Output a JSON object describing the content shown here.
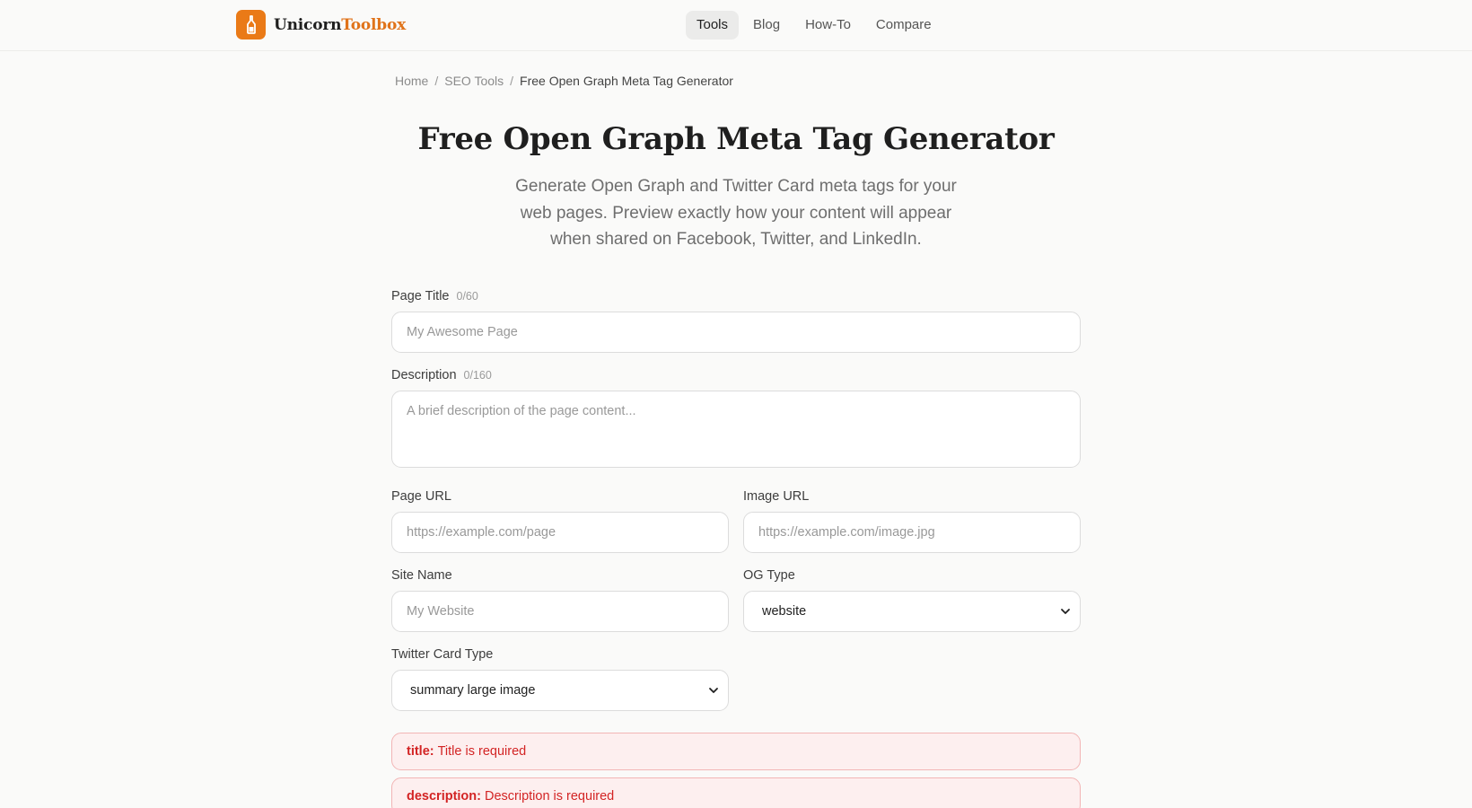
{
  "header": {
    "logo": {
      "part1": "Unicorn",
      "part2": "Toolbox",
      "icon": "unicorn-bottle-icon"
    },
    "nav": [
      {
        "label": "Tools",
        "active": true
      },
      {
        "label": "Blog",
        "active": false
      },
      {
        "label": "How-To",
        "active": false
      },
      {
        "label": "Compare",
        "active": false
      }
    ]
  },
  "breadcrumb": {
    "home": "Home",
    "section": "SEO Tools",
    "current": "Free Open Graph Meta Tag Generator",
    "separator": "/"
  },
  "page": {
    "title": "Free Open Graph Meta Tag Generator",
    "subtitle": "Generate Open Graph and Twitter Card meta tags for your web pages. Preview exactly how your content will appear when shared on Facebook, Twitter, and LinkedIn."
  },
  "form": {
    "page_title": {
      "label": "Page Title",
      "count": "0/60",
      "placeholder": "My Awesome Page",
      "value": ""
    },
    "description": {
      "label": "Description",
      "count": "0/160",
      "placeholder": "A brief description of the page content...",
      "value": ""
    },
    "page_url": {
      "label": "Page URL",
      "placeholder": "https://example.com/page",
      "value": ""
    },
    "image_url": {
      "label": "Image URL",
      "placeholder": "https://example.com/image.jpg",
      "value": ""
    },
    "site_name": {
      "label": "Site Name",
      "placeholder": "My Website",
      "value": ""
    },
    "og_type": {
      "label": "OG Type",
      "selected": "website"
    },
    "twitter_card": {
      "label": "Twitter Card Type",
      "selected": "summary large image"
    }
  },
  "errors": [
    {
      "key": "title:",
      "message": "Title is required"
    },
    {
      "key": "description:",
      "message": "Description is required"
    }
  ],
  "colors": {
    "accent": "#ea7a17",
    "error_text": "#d32424",
    "error_bg": "#fdefef"
  }
}
